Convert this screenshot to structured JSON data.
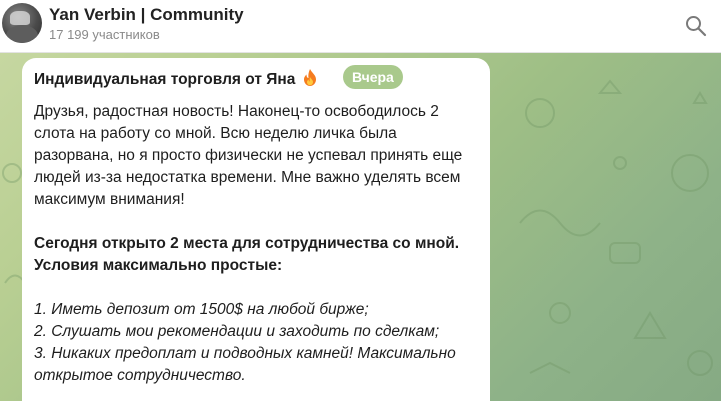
{
  "header": {
    "title": "Yan Verbin | Community",
    "subtitle": "17 199 участников",
    "search_icon": "search-icon",
    "avatar_icon": "avatar"
  },
  "date_badge": "Вчера",
  "post": {
    "title": "Индивидуальная торговля от Яна",
    "title_icon": "fire-icon",
    "paragraph1": "Друзья, радостная новость! Наконец-то освободилось 2 слота на работу со мной. Всю неделю личка была разорвана, но я просто физически не успевал принять еще людей из-за недостатка времени. Мне важно уделять всем максимум внимания!",
    "paragraph2": "Сегодня открыто 2 места для сотрудничества со мной. Условия максимально простые:",
    "list": [
      "1. Иметь депозит от 1500$ на любой бирже;",
      "2. Слушать мои рекомендации и заходить по сделкам;",
      "3. Никаких предоплат и подводных камней! Максимально открытое сотрудничество."
    ]
  },
  "colors": {
    "header_bg": "#ffffff",
    "title": "#222222",
    "subtitle": "#8a8a8a",
    "badge_bg": "#a9c98c",
    "wallpaper": "#a8c48d"
  }
}
